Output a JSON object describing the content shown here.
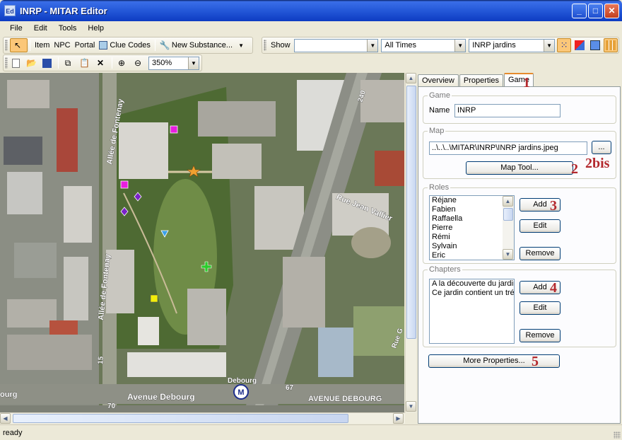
{
  "window": {
    "app_icon": "Ed",
    "title": "INRP  - MITAR Editor"
  },
  "menu": [
    "File",
    "Edit",
    "Tools",
    "Help"
  ],
  "toolbar1": {
    "item": "Item",
    "npc": "NPC",
    "portal": "Portal",
    "clue_codes": "Clue Codes",
    "new_substance": "New Substance..."
  },
  "toolbar2": {
    "show_label": "Show",
    "show_value": "",
    "times_value": "All Times",
    "map_value": "INRP jardins"
  },
  "toolbar3": {
    "zoom_value": "350%"
  },
  "map": {
    "streets": {
      "allee_top": "Allée de Fontenay",
      "allee_bottom": "Allée de Fontenay",
      "rue_jean_vallier": "Rue Jean Vallier",
      "avenue_debourg_left": "Avenue Debourg",
      "avenue_debourg_right": "AVENUE DEBOURG",
      "debourg": "Debourg",
      "num_240": "240",
      "num_15": "15",
      "num_70": "70",
      "num_67": "67",
      "edge_left": "ourg",
      "edge_right": "Rue G"
    },
    "metro": "M"
  },
  "tabs": {
    "overview": "Overview",
    "properties": "Properties",
    "game": "Game"
  },
  "game_group": {
    "legend": "Game",
    "name_label": "Name",
    "name_value": "INRP"
  },
  "map_group": {
    "legend": "Map",
    "path": "..\\..\\..\\MITAR\\INRP\\INRP jardins.jpeg",
    "browse": "...",
    "map_tool": "Map Tool..."
  },
  "roles": {
    "legend": "Roles",
    "items": [
      "Réjane",
      "Fabien",
      "Raffaella",
      "Pierre",
      "Rémi",
      "Sylvain",
      "Eric"
    ],
    "add": "Add",
    "edit": "Edit",
    "remove": "Remove"
  },
  "chapters": {
    "legend": "Chapters",
    "items": [
      "A la découverte du jardin",
      "Ce jardin contient un trés"
    ],
    "add": "Add",
    "edit": "Edit",
    "remove": "Remove"
  },
  "more_properties": "More Properties...",
  "annotations": {
    "a1": "1",
    "a2bis": "2bis",
    "a2": "2",
    "a3": "3",
    "a4": "4",
    "a5": "5"
  },
  "status": "ready",
  "colors": {
    "title_blue": "#2458d8",
    "annotation_red": "#b3282d",
    "marker_magenta": "#e81ee0",
    "marker_purple": "#7a22c8",
    "marker_yellow": "#f2ee0a",
    "marker_green": "#2ccc2c",
    "marker_orange": "#f0a030"
  }
}
